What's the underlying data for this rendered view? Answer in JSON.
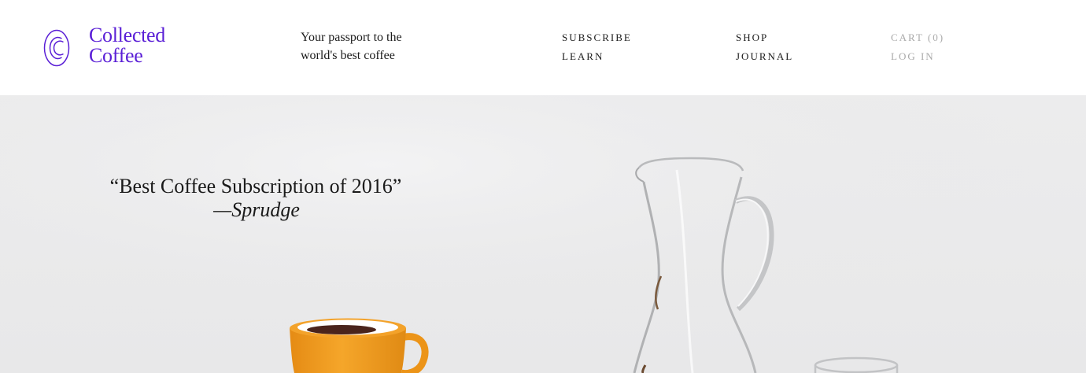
{
  "brand": {
    "line1": "Collected",
    "line2": "Coffee",
    "color": "#5a1fd6",
    "logo_icon": "double-c-logo-icon"
  },
  "tagline": {
    "line1": "Your passport to the",
    "line2": "world's best coffee"
  },
  "nav": {
    "subscribe": "SUBSCRIBE",
    "learn": "LEARN",
    "shop": "SHOP",
    "journal": "JOURNAL",
    "cart": "CART (0)",
    "login": "LOG IN"
  },
  "hero": {
    "quote": "“Best Coffee Subscription of 2016”",
    "source": "—Sprudge",
    "image_subjects": [
      "orange-coffee-mug",
      "glass-chemex-carafe",
      "glass-cup"
    ]
  }
}
